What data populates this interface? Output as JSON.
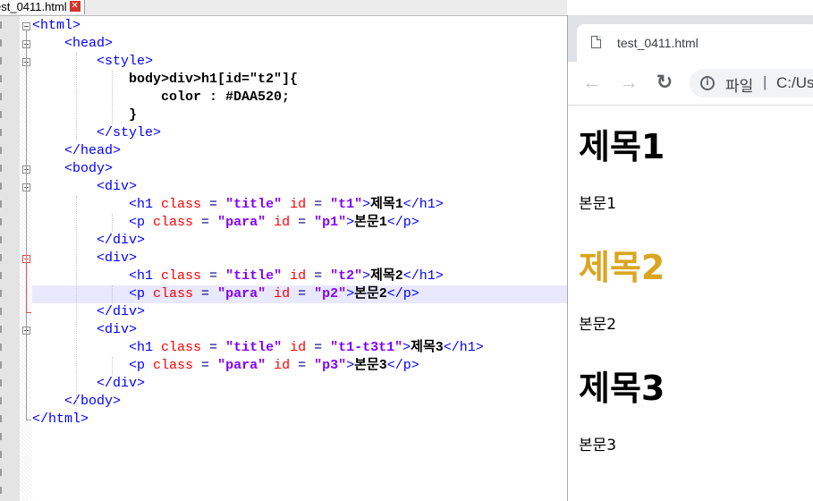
{
  "editor": {
    "tab_label": "est_0411.html",
    "close_glyph": "✕",
    "lines": [
      [
        [
          "tg",
          "<html>"
        ]
      ],
      [
        [
          "tg",
          "    <head>"
        ]
      ],
      [
        [
          "tg",
          "        <style>"
        ]
      ],
      [
        [
          "cs",
          "            body>div>h1[id=\"t2\"]{"
        ]
      ],
      [
        [
          "cs",
          "                color : #DAA520;"
        ]
      ],
      [
        [
          "cs",
          "            }"
        ]
      ],
      [
        [
          "tg",
          "        </style>"
        ]
      ],
      [
        [
          "tg",
          "    </head>"
        ]
      ],
      [
        [
          "tg",
          "    <body>"
        ]
      ],
      [
        [
          "tg",
          "        <div>"
        ]
      ],
      [
        [
          "tg",
          "            <h1 "
        ],
        [
          "at",
          "class"
        ],
        [
          "eq",
          " = "
        ],
        [
          "vl",
          "\"title\""
        ],
        [
          "at",
          " id"
        ],
        [
          "eq",
          " = "
        ],
        [
          "vl",
          "\"t1\""
        ],
        [
          "tg",
          ">"
        ],
        [
          "tx",
          "제목1"
        ],
        [
          "tg",
          "</h1>"
        ]
      ],
      [
        [
          "tg",
          "            <p "
        ],
        [
          "at",
          "class"
        ],
        [
          "eq",
          " = "
        ],
        [
          "vl",
          "\"para\""
        ],
        [
          "at",
          " id"
        ],
        [
          "eq",
          " = "
        ],
        [
          "vl",
          "\"p1\""
        ],
        [
          "tg",
          ">"
        ],
        [
          "tx",
          "본문1"
        ],
        [
          "tg",
          "</p>"
        ]
      ],
      [
        [
          "tg",
          "        </div>"
        ]
      ],
      [
        [
          "tg",
          "        <div>"
        ]
      ],
      [
        [
          "tg",
          "            <h1 "
        ],
        [
          "at",
          "class"
        ],
        [
          "eq",
          " = "
        ],
        [
          "vl",
          "\"title\""
        ],
        [
          "at",
          " id"
        ],
        [
          "eq",
          " = "
        ],
        [
          "vl",
          "\"t2\""
        ],
        [
          "tg",
          ">"
        ],
        [
          "tx",
          "제목2"
        ],
        [
          "tg",
          "</h1>"
        ]
      ],
      [
        [
          "tg",
          "            <p "
        ],
        [
          "at",
          "class"
        ],
        [
          "eq",
          " = "
        ],
        [
          "vl",
          "\"para\""
        ],
        [
          "at",
          " id"
        ],
        [
          "eq",
          " = "
        ],
        [
          "vl",
          "\"p2\""
        ],
        [
          "tg",
          ">"
        ],
        [
          "tx",
          "본문2"
        ],
        [
          "tg",
          "</p>"
        ]
      ],
      [
        [
          "tg",
          "        </div>"
        ]
      ],
      [
        [
          "tg",
          "        <div>"
        ]
      ],
      [
        [
          "tg",
          "            <h1 "
        ],
        [
          "at",
          "class"
        ],
        [
          "eq",
          " = "
        ],
        [
          "vl",
          "\"title\""
        ],
        [
          "at",
          " id"
        ],
        [
          "eq",
          " = "
        ],
        [
          "vl",
          "\"t1-t3t1\""
        ],
        [
          "tg",
          ">"
        ],
        [
          "tx",
          "제목3"
        ],
        [
          "tg",
          "</h1>"
        ]
      ],
      [
        [
          "tg",
          "            <p "
        ],
        [
          "at",
          "class"
        ],
        [
          "eq",
          " = "
        ],
        [
          "vl",
          "\"para\""
        ],
        [
          "at",
          " id"
        ],
        [
          "eq",
          " = "
        ],
        [
          "vl",
          "\"p3\""
        ],
        [
          "tg",
          ">"
        ],
        [
          "tx",
          "본문3"
        ],
        [
          "tg",
          "</p>"
        ]
      ],
      [
        [
          "tg",
          "        </div>"
        ]
      ],
      [
        [
          "tg",
          "    </body>"
        ]
      ],
      [
        [
          "tg",
          "</html>"
        ]
      ]
    ],
    "highlighted_line": 15,
    "colors": {
      "tag": "#0000ff",
      "attr": "#ff0000",
      "value": "#8000ff",
      "highlight": "#e8e8ff"
    }
  },
  "browser": {
    "tab_title": "test_0411.html",
    "back_glyph": "←",
    "forward_glyph": "→",
    "reload_glyph": "↻",
    "info_glyph": "i",
    "omnibox_scheme": "파일",
    "omnibox_sep": "|",
    "omnibox_url": "C:/Us",
    "content": {
      "h1_1": "제목1",
      "p_1": "본문1",
      "h1_2": "제목2",
      "p_2": "본문2",
      "h1_3": "제목3",
      "p_3": "본문3"
    },
    "h1_2_color": "#DAA520"
  }
}
